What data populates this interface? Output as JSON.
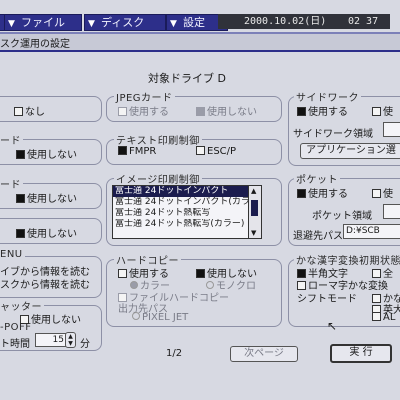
{
  "menubar": {
    "file": "ファイル",
    "disk": "ディスク",
    "settings": "設定",
    "clock_date": "2000.10.02(日)",
    "clock_time": "02 37"
  },
  "dialog": {
    "title": "スク運用の設定",
    "target_drive": "対象ドライブ D"
  },
  "left": {
    "opt_none": "なし",
    "card_label": "ード",
    "card_none": "使用しない",
    "board_label": "ード",
    "board_none": "使用しない",
    "misc_none": "使用しない",
    "menu_label": "ENU",
    "menu_opt1": "イブから情報を読む",
    "menu_opt2": "スクから情報を読む",
    "shutter_label": "ャッター",
    "shutter_none": "使用しない",
    "poff_label": "-POFF",
    "timer_label": "ト時間",
    "timer_value": "15",
    "timer_unit": "分"
  },
  "jpeg": {
    "label": "JPEGカード",
    "use": "使用する",
    "no_use": "使用しない"
  },
  "text_print": {
    "label": "テキスト印刷制御",
    "fmpr": "FMPR",
    "escp": "ESC/P"
  },
  "image_print": {
    "label": "イメージ印刷制御",
    "items": [
      "富士通 24ドットインパクト",
      "富士通 24ドットインパクト(カラー)",
      "富士通 24ドット熱転写",
      "富士通 24ドット熱転写(カラー)"
    ]
  },
  "hardcopy": {
    "label": "ハードコピー",
    "use": "使用する",
    "no_use": "使用しない",
    "color": "カラー",
    "mono": "モノクロ",
    "file_copy": "ファイルハードコピー",
    "dest_label": "出力先パス",
    "dest_value": "PIXEL JET"
  },
  "sidework": {
    "label": "サイドワーク",
    "use": "使用する",
    "no_use": "使",
    "area_label": "サイドワーク領域",
    "app_button": "アプリケーション選"
  },
  "pocket": {
    "label": "ポケット",
    "use": "使用する",
    "no_use": "使",
    "area_label": "ポケット領域",
    "path_label": "退避先パス",
    "path_value": "D:¥SCB"
  },
  "kana": {
    "label": "かな漢字変換初期状態",
    "half": "半角文字",
    "full": "全",
    "romaji": "ローマ字かな変換",
    "shift_label": "シフトモード",
    "opt1": "かな",
    "opt2": "英大",
    "opt3": "AL"
  },
  "footer": {
    "page": "1/2",
    "next_page": "次ページ",
    "execute": "実 行"
  }
}
